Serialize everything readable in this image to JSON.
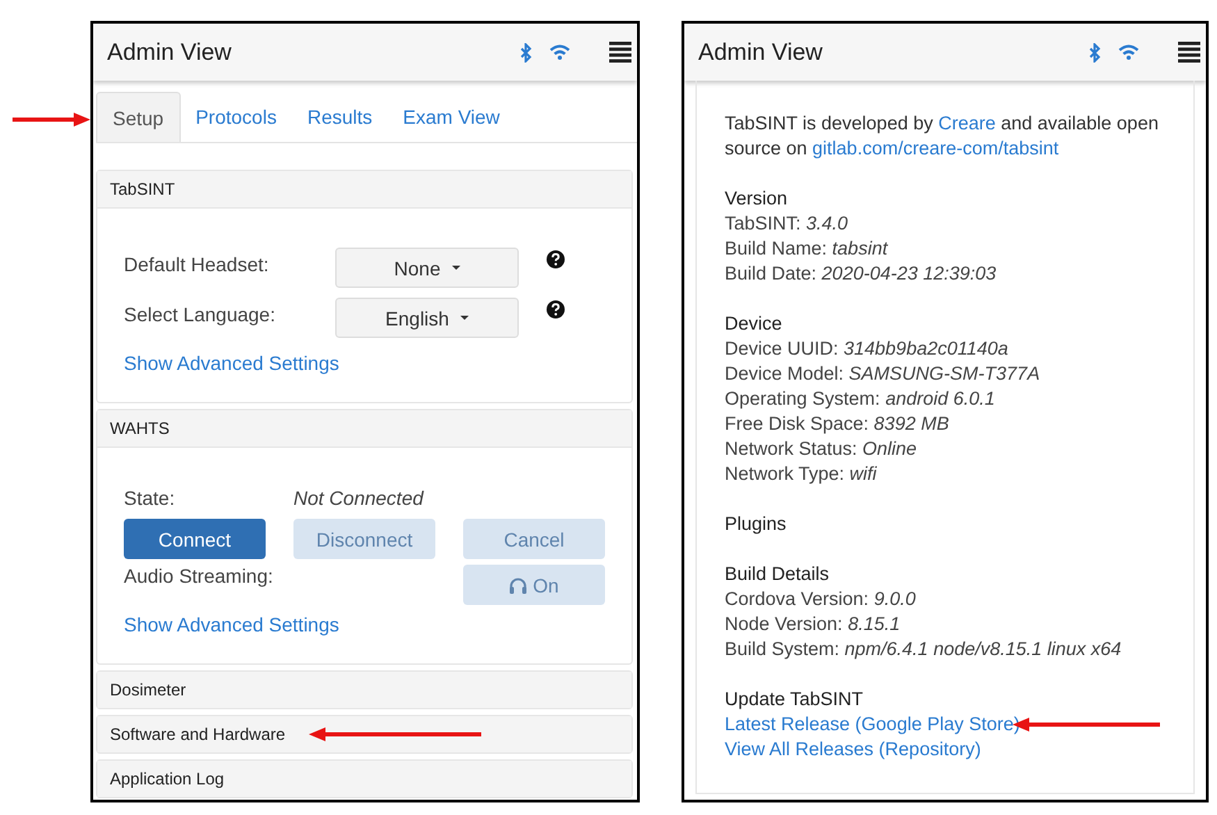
{
  "left_screen": {
    "title": "Admin View",
    "tabs": [
      {
        "label": "Setup",
        "selected": true
      },
      {
        "label": "Protocols",
        "selected": false
      },
      {
        "label": "Results",
        "selected": false
      },
      {
        "label": "Exam View",
        "selected": false
      }
    ],
    "tabsint_panel": {
      "heading": "TabSINT",
      "settings": [
        {
          "label": "Default Headset:",
          "value": "None"
        },
        {
          "label": "Select Language:",
          "value": "English"
        }
      ],
      "advanced_link": "Show Advanced Settings"
    },
    "wahts_panel": {
      "heading": "WAHTS",
      "state_label": "State:",
      "state_value": "Not Connected",
      "buttons": [
        {
          "label": "Connect",
          "disabled": false
        },
        {
          "label": "Disconnect",
          "disabled": true
        },
        {
          "label": "Cancel",
          "disabled": true
        }
      ],
      "audio_label": "Audio Streaming:",
      "audio_button": {
        "label": "On",
        "disabled": true
      },
      "advanced_link": "Show Advanced Settings"
    },
    "collapsed_panels": [
      "Dosimeter",
      "Software and Hardware",
      "Application Log"
    ]
  },
  "right_screen": {
    "title": "Admin View",
    "intro": {
      "before": "TabSINT is developed by ",
      "link_1": "Creare",
      "middle": " and available open source on ",
      "link_2": "gitlab.com/creare-com/tabsint"
    },
    "sections": [
      {
        "heading": "Version",
        "rows": [
          "TabSINT: *3.4.0*",
          "Build Name: *tabsint*",
          "Build Date: *2020-04-23 12:39:03*"
        ]
      },
      {
        "heading": "Device",
        "rows": [
          "Device UUID: *314bb9ba2c01140a*",
          "Device Model: *SAMSUNG-SM-T377A*",
          "Operating System: *android 6.0.1*",
          "Free Disk Space: *8392 MB*",
          "Network Status: *Online*",
          "Network Type: *wifi*"
        ]
      },
      {
        "heading": "Plugins"
      },
      {
        "heading": "Build Details",
        "rows": [
          "Cordova Version: *9.0.0*",
          "Node Version: *8.15.1*",
          "Build System: *npm/6.4.1 node/v8.15.1 linux x64*"
        ]
      },
      {
        "heading": "Update TabSINT",
        "links": [
          "Latest Release (Google Play Store)",
          "View All Releases (Repository)"
        ]
      }
    ]
  }
}
